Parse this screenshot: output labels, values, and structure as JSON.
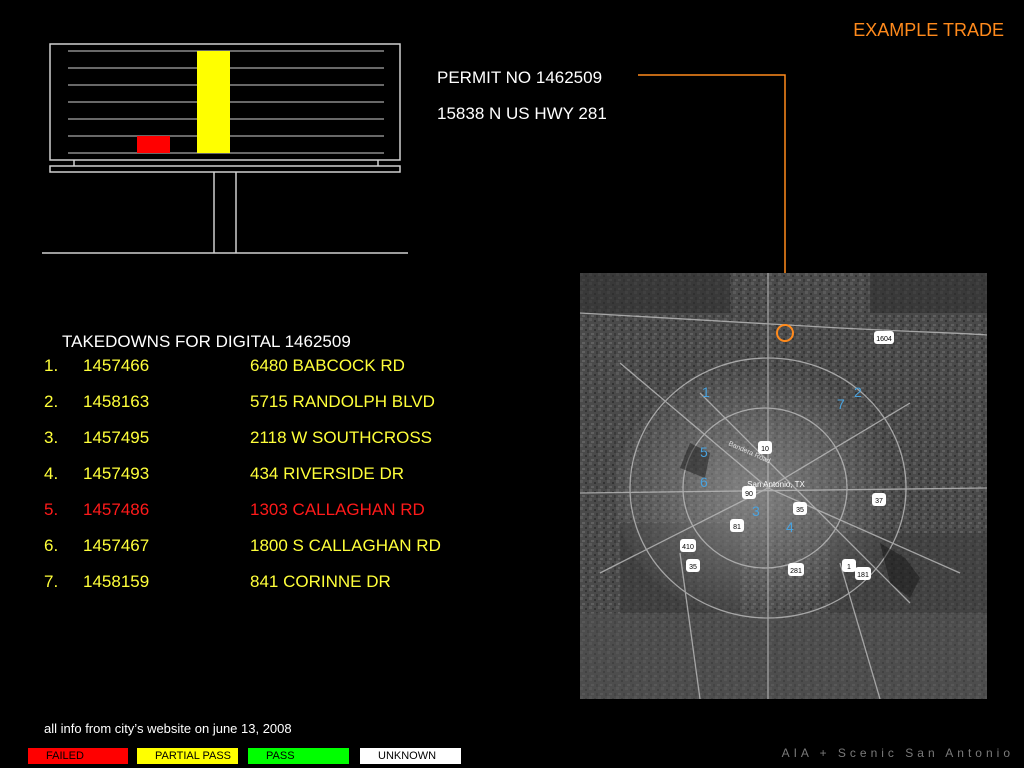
{
  "slide_title": "EXAMPLE TRADE",
  "permit_label": "PERMIT NO 1462509",
  "permit_address": "15838 N US HWY 281",
  "takedowns_heading": "TAKEDOWNS FOR DIGITAL 1462509",
  "takedowns": [
    {
      "num": "1.",
      "permit": "1457466",
      "address": "6480 BABCOCK RD",
      "status": "partial",
      "color": "#ffff3a"
    },
    {
      "num": "2.",
      "permit": "1458163",
      "address": "5715 RANDOLPH BLVD",
      "status": "partial",
      "color": "#ffff3a"
    },
    {
      "num": "3.",
      "permit": "1457495",
      "address": "2118 W SOUTHCROSS",
      "status": "partial",
      "color": "#ffff3a"
    },
    {
      "num": "4.",
      "permit": "1457493",
      "address": "434 RIVERSIDE DR",
      "status": "partial",
      "color": "#ffff3a"
    },
    {
      "num": "5.",
      "permit": "1457486",
      "address": "1303 CALLAGHAN RD",
      "status": "failed",
      "color": "#ff1a1a"
    },
    {
      "num": "6.",
      "permit": "1457467",
      "address": "1800 S CALLAGHAN RD",
      "status": "partial",
      "color": "#ffff3a"
    },
    {
      "num": "7.",
      "permit": "1458159",
      "address": "841 CORINNE DR",
      "status": "partial",
      "color": "#ffff3a"
    }
  ],
  "footnote": "all info from city’s website on june 13, 2008",
  "legend": [
    {
      "label": "FAILED",
      "bg": "#ff0000",
      "fg": "#000000"
    },
    {
      "label": "PARTIAL PASS",
      "bg": "#ffff00",
      "fg": "#000000"
    },
    {
      "label": "PASS",
      "bg": "#00ff00",
      "fg": "#000000"
    },
    {
      "label": "UNKNOWN",
      "bg": "#ffffff",
      "fg": "#000000"
    }
  ],
  "credit": "AIA + Scenic San Antonio",
  "map": {
    "city_label": "San Antonio, TX",
    "street_label": "Bandera Road",
    "markers": [
      "1",
      "2",
      "3",
      "4",
      "5",
      "6",
      "7"
    ],
    "highway_shields": [
      "1604",
      "10",
      "90",
      "35",
      "81",
      "37",
      "410",
      "35",
      "281",
      "1",
      "181",
      "35"
    ],
    "marker_color": "#4aa3df",
    "target_color": "#ff8a1c"
  },
  "billboard_chart": {
    "bars": [
      {
        "status": "failed",
        "color": "#ff0000"
      },
      {
        "status": "partial pass",
        "color": "#ffff00"
      }
    ]
  },
  "colors": {
    "accent": "#ff8a1c",
    "partial": "#ffff3a",
    "failed": "#ff1a1a"
  }
}
